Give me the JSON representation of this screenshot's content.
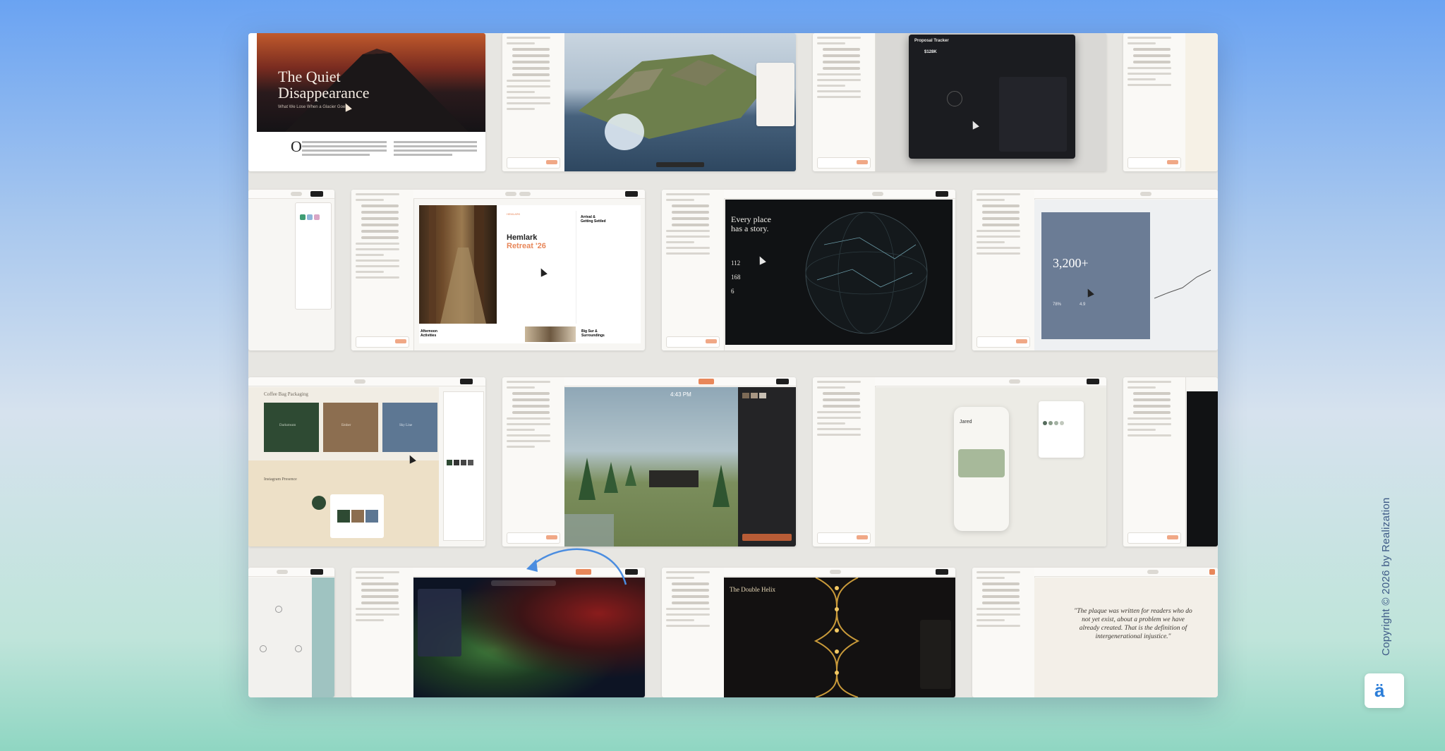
{
  "copyright": "Copyright © 2026 by Realization",
  "logo_glyph": "ä",
  "panels": {
    "quiet": {
      "title_l1": "The Quiet",
      "title_l2": "Disappearance",
      "subtitle": "What We Lose When a Glacier Goes",
      "dropcap": "O"
    },
    "proposal": {
      "title": "Proposal Tracker",
      "amount": "$128K"
    },
    "hemlark": {
      "eyebrow": "HEMLARK",
      "title_l1": "Hemlark",
      "title_l2": "Retreat '26",
      "side_title_l1": "Arrival &",
      "side_title_l2": "Getting Settled",
      "footer_l1": "Afternoon",
      "footer_l2": "Activities",
      "footer_r1": "Big Sur &",
      "footer_r2": "Surroundings"
    },
    "globe": {
      "headline_l1": "Every place",
      "headline_l2": "has a story.",
      "stats": [
        "112",
        "168",
        "6"
      ]
    },
    "stat": {
      "big": "3,200+",
      "small1": "78%",
      "small2": "4.9"
    },
    "brand": {
      "heading": "Coffee Bag Packaging",
      "swatches": [
        "Darkstream",
        "Ember",
        "Sky Line"
      ],
      "lower_heading": "Instagram Presence"
    },
    "forest": {
      "time": "4:43 PM"
    },
    "phone": {
      "name": "Jared"
    },
    "helix": {
      "title": "The Double Helix"
    },
    "quote": {
      "text_l1": "\"The plaque was written for readers who do",
      "text_l2": "not yet exist, about a problem we have",
      "text_l3": "already created. That is the definition of",
      "text_l4": "intergenerational injustice.\""
    }
  },
  "colors": {
    "accent": "#e8875a",
    "dark": "#1e1e1e",
    "forest_green": "#2e4a33",
    "tan": "#8c6e50",
    "slate_blue": "#5d7793"
  }
}
